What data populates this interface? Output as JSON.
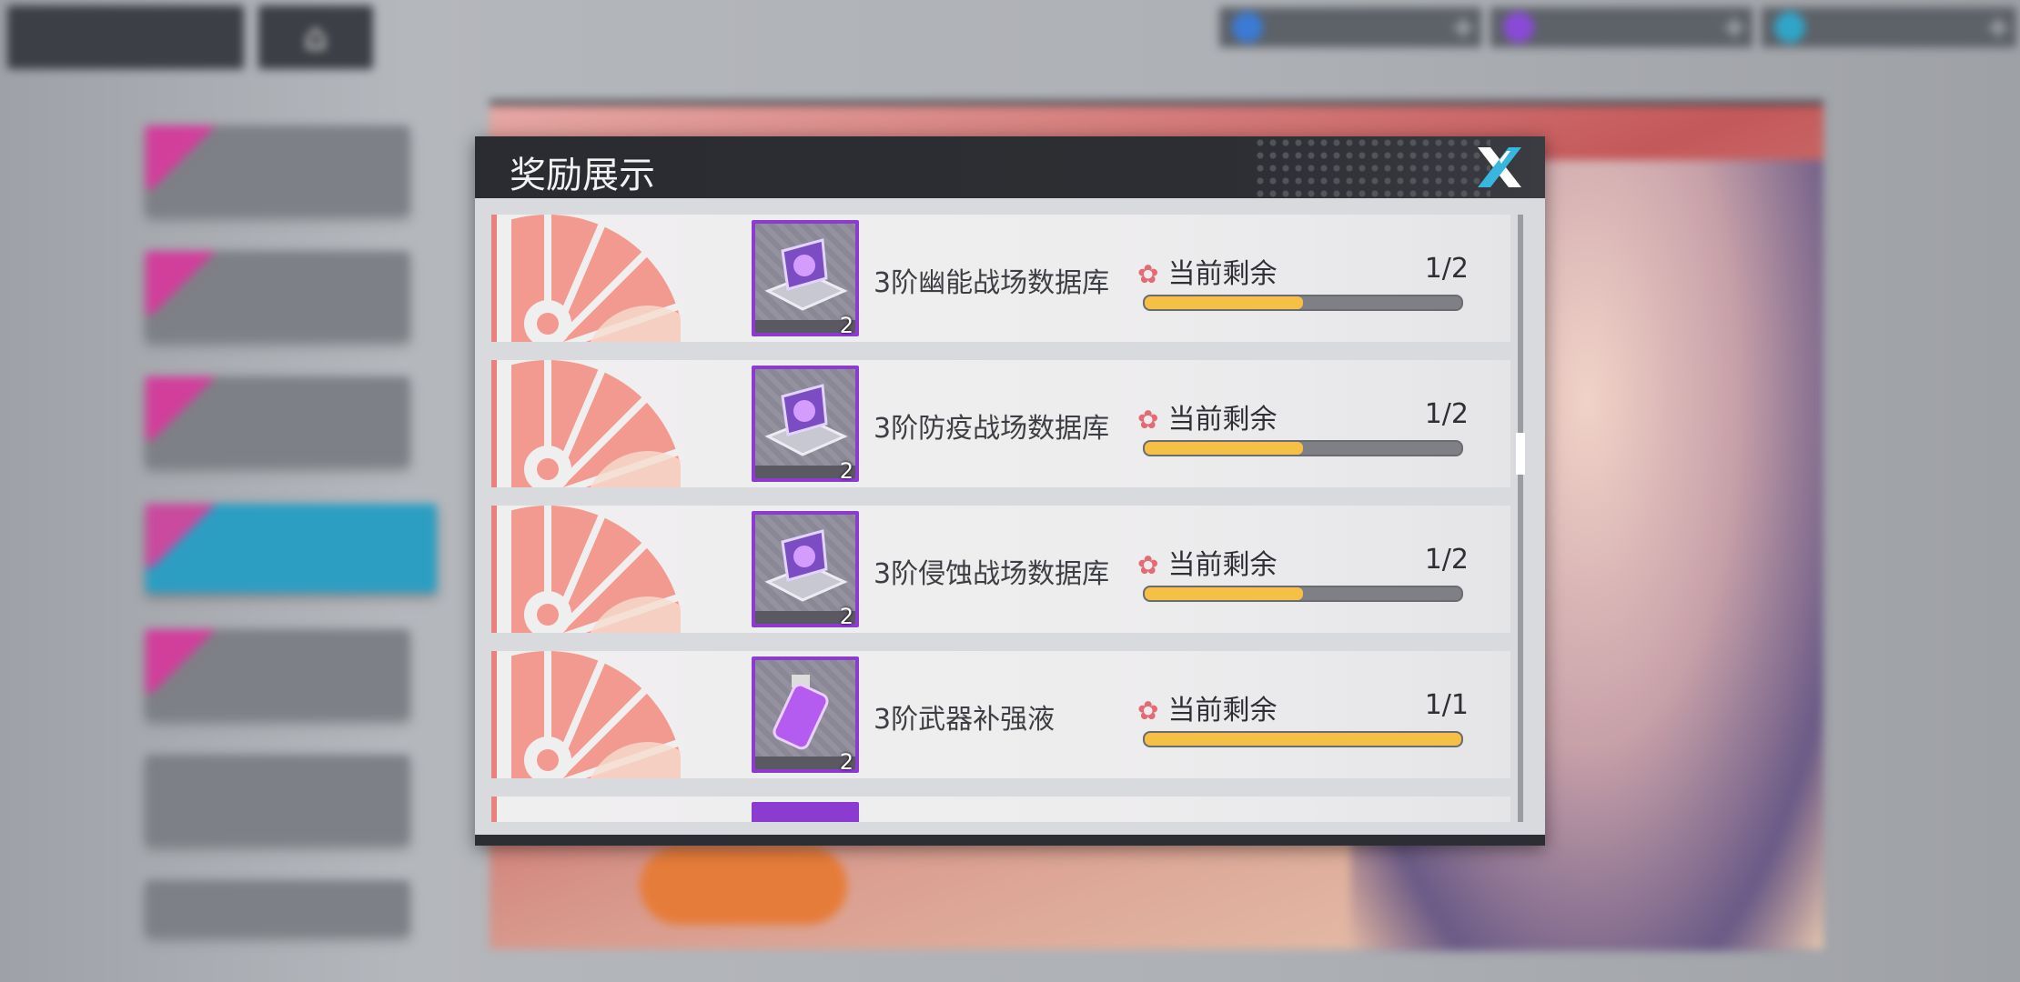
{
  "dialog": {
    "title": "奖励展示",
    "remain_label": "当前剩余"
  },
  "rewards": [
    {
      "name": "3阶幽能战场数据库",
      "qty": "2",
      "count": "1/2",
      "progress": 0.5
    },
    {
      "name": "3阶防疫战场数据库",
      "qty": "2",
      "count": "1/2",
      "progress": 0.5
    },
    {
      "name": "3阶侵蚀战场数据库",
      "qty": "2",
      "count": "1/2",
      "progress": 0.5
    },
    {
      "name": "3阶武器补强液",
      "qty": "2",
      "count": "1/1",
      "progress": 1.0
    }
  ],
  "colors": {
    "item_frame": "#8c3bd0",
    "progress_fill": "#f6bf45",
    "accent_pink": "#e9827f",
    "active_tab": "#2b9ec2"
  },
  "icons": [
    "close-icon",
    "flower-icon",
    "data-chip-icon",
    "spray-bottle-icon"
  ]
}
